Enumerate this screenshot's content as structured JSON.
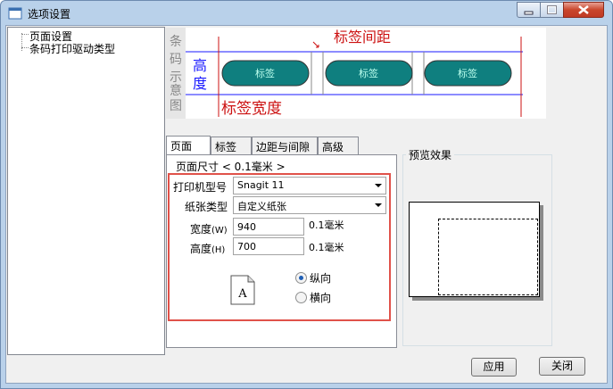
{
  "window": {
    "title": "选项设置"
  },
  "tree": {
    "items": [
      "页面设置",
      "条码打印驱动类型"
    ]
  },
  "diagram": {
    "barcode_vertical": "条码示意图",
    "height_label": "高度",
    "spacing_label": "标签间距",
    "width_label": "标签宽度",
    "labels": [
      "标签",
      "标签",
      "标签"
    ]
  },
  "tabs": [
    "页面",
    "标签",
    "边距与间隙",
    "高级"
  ],
  "page_tab": {
    "unit_caption": "页面尺寸 < 0.1毫米 >",
    "printer_label": "打印机型号",
    "printer_value": "Snagit 11",
    "paper_type_label": "纸张类型",
    "paper_type_value": "自定义纸张",
    "width_label": "宽度",
    "width_hotkey": "(W)",
    "width_value": "940",
    "width_unit": "0.1毫米",
    "height_label": "高度",
    "height_hotkey": "(H)",
    "height_value": "700",
    "height_unit": "0.1毫米",
    "orientation_icon_letter": "A",
    "portrait_label": "纵向",
    "landscape_label": "横向",
    "orientation_selected": "纵向"
  },
  "preview": {
    "title": "预览效果"
  },
  "buttons": {
    "apply": "应用",
    "close": "关闭"
  },
  "colors": {
    "highlight_box": "#e0524a",
    "label_shape_fill": "#0f7f7f",
    "diagram_red": "#cc1111",
    "diagram_blue": "#1a1aff"
  }
}
